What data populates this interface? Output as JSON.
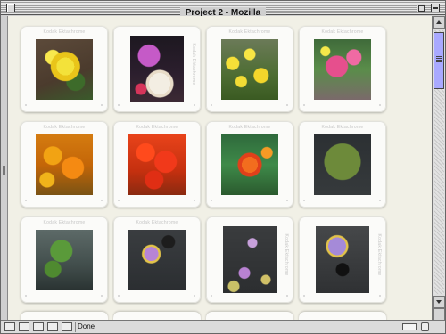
{
  "window": {
    "title": "Project 2 - Mozilla"
  },
  "slides": [
    {
      "label": "Kodak Ektachrome",
      "photo": "yellow-daffodil"
    },
    {
      "label": "Kodak Ektachrome",
      "photo": "chrysanthemums"
    },
    {
      "label": "Kodak Ektachrome",
      "photo": "daffodils"
    },
    {
      "label": "Kodak Ektachrome",
      "photo": "hyacinths"
    },
    {
      "label": "Kodak Ektachrome",
      "photo": "orange-flowers"
    },
    {
      "label": "Kodak Ektachrome",
      "photo": "red-flowers"
    },
    {
      "label": "Kodak Ektachrome",
      "photo": "zinnias"
    },
    {
      "label": "Kodak Ektachrome",
      "photo": "lily-pads"
    },
    {
      "label": "Kodak Ektachrome",
      "photo": "pond-plants"
    },
    {
      "label": "Kodak Ektachrome",
      "photo": "water-lily"
    },
    {
      "label": "Kodak Ektachrome",
      "photo": "pond-lilies"
    },
    {
      "label": "Kodak Ektachrome",
      "photo": "purple-water-lily"
    }
  ],
  "statusbar": {
    "status": "Done",
    "icons": [
      "navigator-icon",
      "mail-icon",
      "composer-icon",
      "address-book-icon",
      "chat-icon"
    ]
  },
  "colors": {
    "page_background": "#f1f0e6",
    "slide_mount": "#fbfbf9",
    "scroll_thumb": "#a9a9ff"
  }
}
